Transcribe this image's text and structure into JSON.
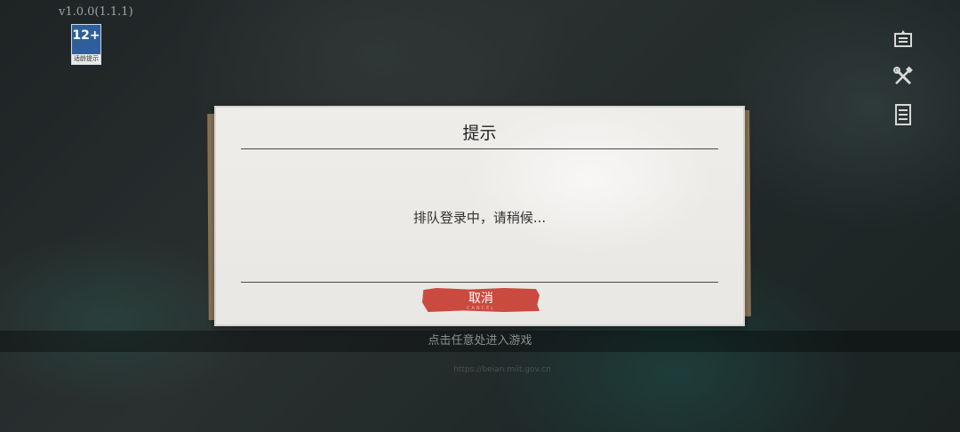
{
  "version": "v1.0.0(1.1.1)",
  "age_rating": {
    "number": "12+",
    "caption": "适龄提示"
  },
  "side_icons": [
    "announcement-icon",
    "tools-icon",
    "notes-icon"
  ],
  "tap_prompt": "点击任意处进入游戏",
  "dialog": {
    "title": "提示",
    "message": "排队登录中，请稍候...",
    "cancel_label": "取消",
    "cancel_sub": "CANCEL"
  },
  "footer_url": "https://beian.miit.gov.cn",
  "colors": {
    "cancel_button": "#c94a3e",
    "dialog_paper": "#efedea",
    "age_badge": "#2f5f9a"
  }
}
